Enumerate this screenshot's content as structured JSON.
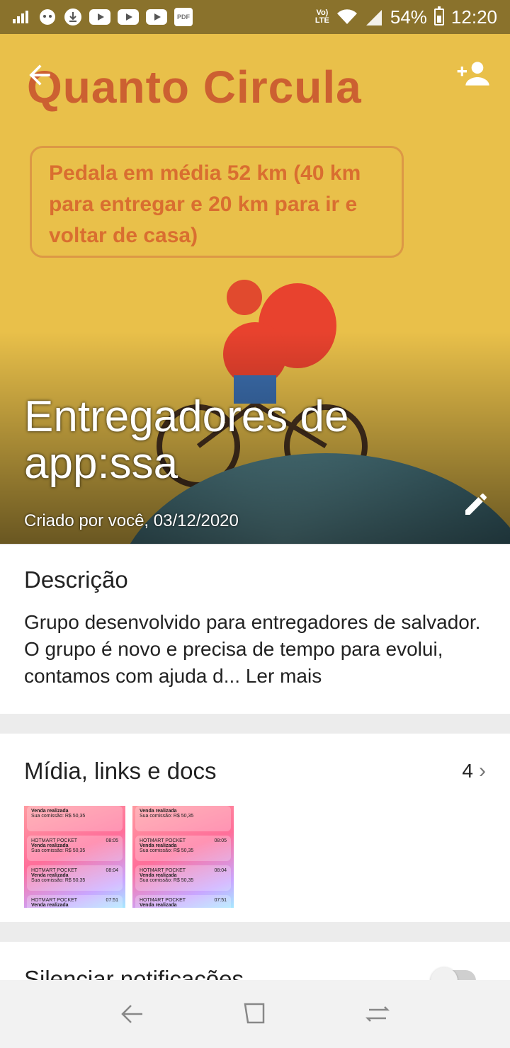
{
  "status_bar": {
    "battery": "54%",
    "time": "12:20",
    "volte": "Vo)\nLTE",
    "icons": [
      "signal-bars-icon",
      "character-icon",
      "download-icon",
      "youtube-icon",
      "youtube-icon",
      "youtube-icon",
      "pdf-icon"
    ],
    "pdf_label": "PDF"
  },
  "header": {
    "poster_title": "Quanto Circula",
    "poster_text": "Pedala em média 52 km (40 km para entregar e 20 km para ir e voltar de casa)",
    "group_name": "Entregadores de app:ssa",
    "created": "Criado por você, 03/12/2020"
  },
  "description": {
    "title": "Descrição",
    "text": "Grupo desenvolvido para entregadores de salvador. O grupo é novo e precisa de tempo para evolui, contamos com ajuda d...",
    "read_more": "Ler mais"
  },
  "media": {
    "title": "Mídia, links e docs",
    "count": "4",
    "thumbs": [
      {
        "items": [
          {
            "app": "",
            "title": "Venda realizada",
            "body": "Sua comissão: R$ 50,35",
            "time": ""
          },
          {
            "app": "HOTMART POCKET",
            "title": "Venda realizada",
            "body": "Sua comissão: R$ 50,35",
            "time": "08:05"
          },
          {
            "app": "HOTMART POCKET",
            "title": "Venda realizada",
            "body": "Sua comissão: R$ 50,35",
            "time": "08:04"
          },
          {
            "app": "HOTMART POCKET",
            "title": "Venda realizada",
            "body": "",
            "time": "07:51"
          }
        ]
      },
      {
        "items": [
          {
            "app": "",
            "title": "Venda realizada",
            "body": "Sua comissão: R$ 50,35",
            "time": ""
          },
          {
            "app": "HOTMART POCKET",
            "title": "Venda realizada",
            "body": "Sua comissão: R$ 50,35",
            "time": "08:05"
          },
          {
            "app": "HOTMART POCKET",
            "title": "Venda realizada",
            "body": "Sua comissão: R$ 50,35",
            "time": "08:04"
          },
          {
            "app": "HOTMART POCKET",
            "title": "Venda realizada",
            "body": "",
            "time": "07:51"
          }
        ]
      }
    ]
  },
  "mute": {
    "label": "Silenciar notificações",
    "enabled": false
  },
  "nav": [
    "back-icon",
    "recents-icon",
    "switch-icon"
  ]
}
